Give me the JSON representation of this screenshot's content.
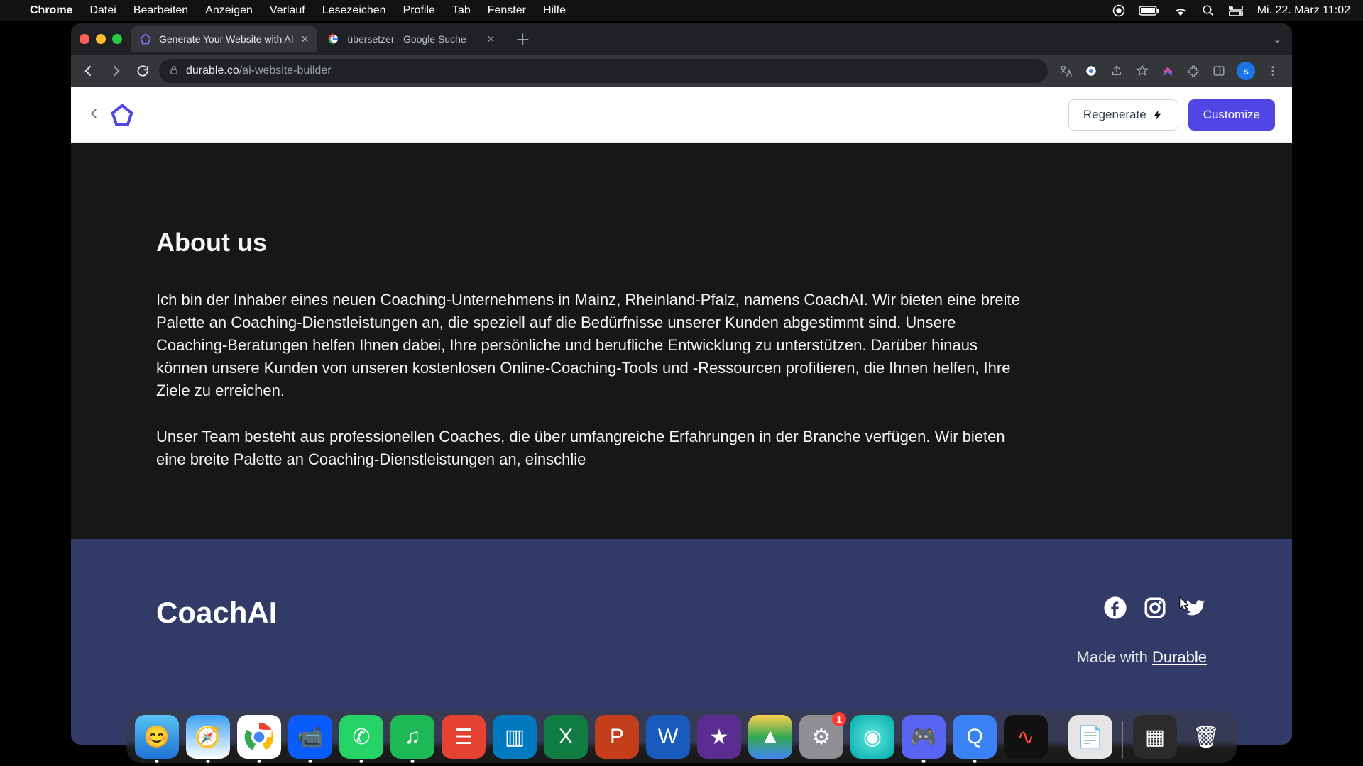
{
  "menubar": {
    "app": "Chrome",
    "items": [
      "Datei",
      "Bearbeiten",
      "Anzeigen",
      "Verlauf",
      "Lesezeichen",
      "Profile",
      "Tab",
      "Fenster",
      "Hilfe"
    ],
    "clock": "Mi. 22. März  11:02"
  },
  "browser": {
    "tabs": [
      {
        "title": "Generate Your Website with AI",
        "active": true
      },
      {
        "title": "übersetzer - Google Suche",
        "active": false
      }
    ],
    "url_host": "durable.co",
    "url_path": "/ai-website-builder",
    "avatar_initial": "s"
  },
  "app": {
    "regenerate": "Regenerate",
    "customize": "Customize"
  },
  "content": {
    "about_heading": "About us",
    "about_p1": "Ich bin der Inhaber eines neuen Coaching-Unternehmens in Mainz, Rheinland-Pfalz, namens CoachAI. Wir bieten eine breite Palette an Coaching-Dienstleistungen an, die speziell auf die Bedürfnisse unserer Kunden abgestimmt sind. Unsere Coaching-Beratungen helfen Ihnen dabei, Ihre persönliche und berufliche Entwicklung zu unterstützen. Darüber hinaus können unsere Kunden von unseren kostenlosen Online-Coaching-Tools und -Ressourcen profitieren, die Ihnen helfen, Ihre Ziele zu erreichen.",
    "about_p2": "Unser Team besteht aus professionellen Coaches, die über umfangreiche Erfahrungen in der Branche verfügen. Wir bieten eine breite Palette an Coaching-Dienstleistungen an, einschlie"
  },
  "footer": {
    "brand": "CoachAI",
    "made_prefix": "Made with ",
    "made_link": "Durable"
  },
  "dock": {
    "settings_badge": "1"
  }
}
